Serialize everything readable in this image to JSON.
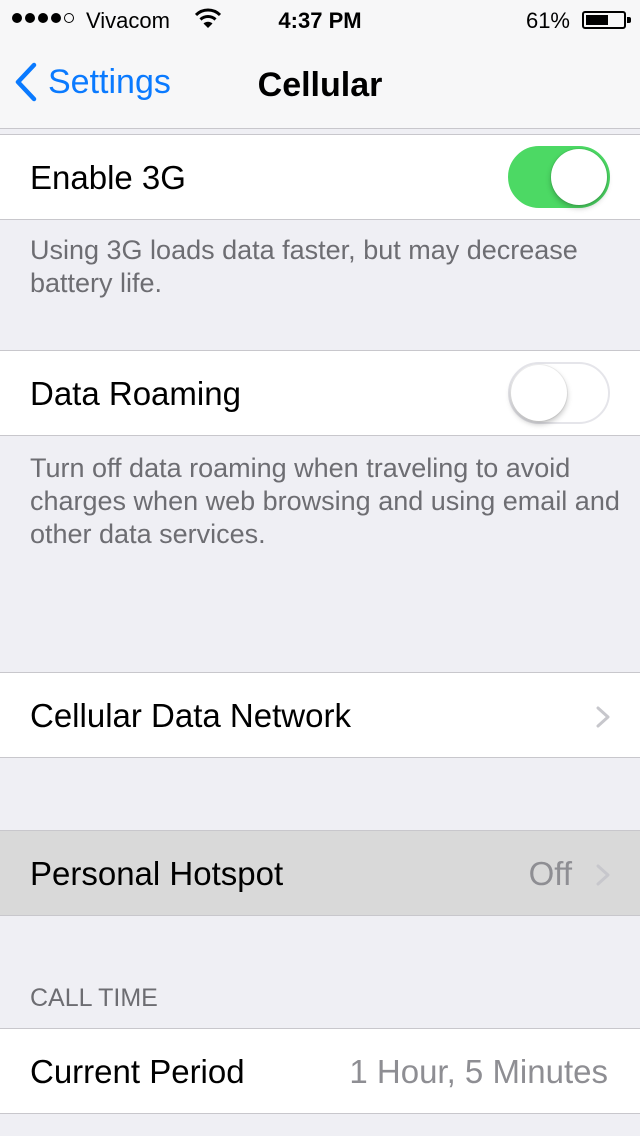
{
  "status_bar": {
    "carrier": "Vivacom",
    "time": "4:37 PM",
    "battery_percent": "61%",
    "battery_level": 0.61,
    "signal_bars": 4,
    "signal_max": 5
  },
  "nav": {
    "back_label": "Settings",
    "title": "Cellular"
  },
  "cells": {
    "enable_3g": {
      "label": "Enable 3G",
      "toggle_on": true
    },
    "enable_3g_footer": "Using 3G loads data faster, but may decrease battery life.",
    "data_roaming": {
      "label": "Data Roaming",
      "toggle_on": false
    },
    "data_roaming_footer": "Turn off data roaming when traveling to avoid charges when web browsing and using email and other data services.",
    "cellular_data_network": {
      "label": "Cellular Data Network"
    },
    "personal_hotspot": {
      "label": "Personal Hotspot",
      "value": "Off"
    }
  },
  "call_time": {
    "header": "CALL TIME",
    "current_period": {
      "label": "Current Period",
      "value": "1 Hour, 5 Minutes"
    }
  },
  "colors": {
    "accent": "#0a7aff",
    "toggle_on": "#4cd964",
    "background": "#efeff4",
    "secondary_text": "#8e8e93"
  },
  "icons": [
    "cellular-signal-icon",
    "wifi-icon",
    "battery-icon",
    "back-chevron-icon",
    "chevron-right-icon"
  ]
}
